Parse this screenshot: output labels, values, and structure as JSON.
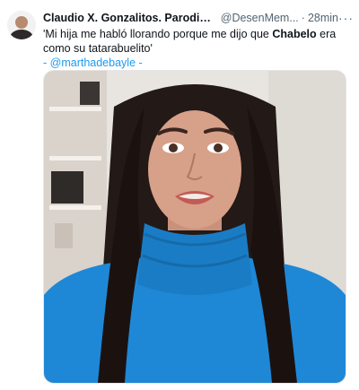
{
  "tweet": {
    "author_name": "Claudio X. Gonzalitos. Parodia. #EsMore...",
    "author_handle": "@DesenMem...",
    "separator": "·",
    "time": "28min",
    "more_label": "···",
    "text_part1": "'Mi hija me habló llorando porque me dijo que ",
    "text_bold": "Chabelo",
    "text_part2": " era como su tatarabuelito'",
    "mention_prefix": "- ",
    "mention": "@marthadebayle",
    "mention_suffix": " -",
    "media_icon": "video-still"
  },
  "colors": {
    "link": "#1d9bf0",
    "secondary_text": "#536471",
    "sweater": "#1e88d6"
  }
}
